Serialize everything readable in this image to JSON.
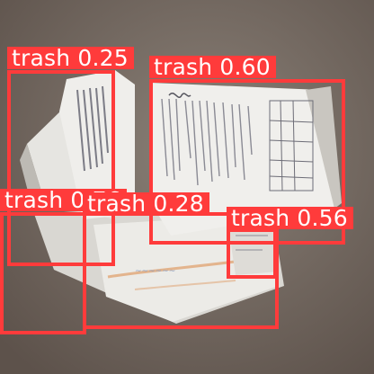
{
  "scene": {
    "description_icon": "crumpled-paper-pile-photo",
    "colors": {
      "background_dark": "#5d524b",
      "background_light": "#8b8178",
      "paper": "#e9e8e5",
      "paper_shadow": "#bdbab4",
      "ink": "#6b6b72",
      "stripe_orange": "#e3b48d",
      "stripe_blue": "#8aa1c7"
    }
  },
  "detections": [
    {
      "id": "det-1",
      "class": "trash",
      "score": "0.25",
      "color": "#ff3b3b"
    },
    {
      "id": "det-2",
      "class": "trash",
      "score": "0.60",
      "color": "#ff3b3b"
    },
    {
      "id": "det-3",
      "class": "trash",
      "score": "0.76",
      "color": "#ff3b3b"
    },
    {
      "id": "det-4",
      "class": "trash",
      "score": "0.28",
      "color": "#ff3b3b"
    },
    {
      "id": "det-5",
      "class": "trash",
      "score": "0.56",
      "color": "#ff3b3b"
    }
  ]
}
